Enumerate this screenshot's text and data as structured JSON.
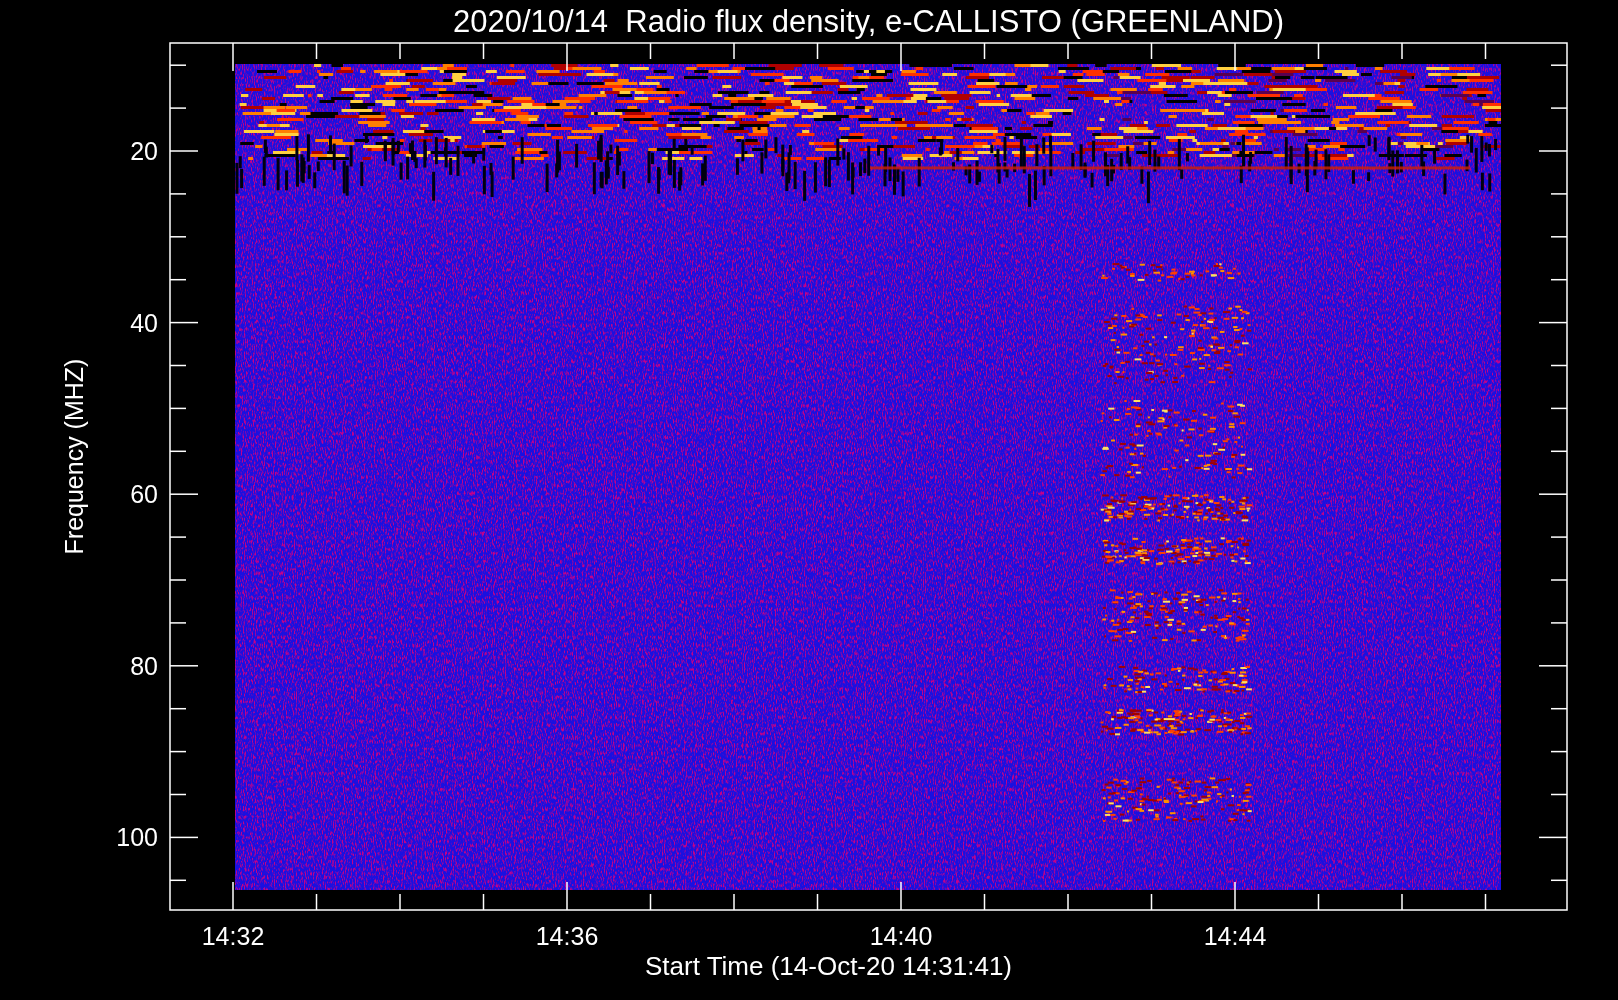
{
  "plot": {
    "title": "2020/10/14  Radio flux density, e-CALLISTO (GREENLAND)",
    "xlabel": "Start Time (14-Oct-20 14:31:41)",
    "ylabel": "Frequency (MHZ)",
    "xticks": [
      "14:32",
      "14:36",
      "14:40",
      "14:44"
    ],
    "yticks": [
      "20",
      "40",
      "60",
      "80",
      "100"
    ]
  }
}
